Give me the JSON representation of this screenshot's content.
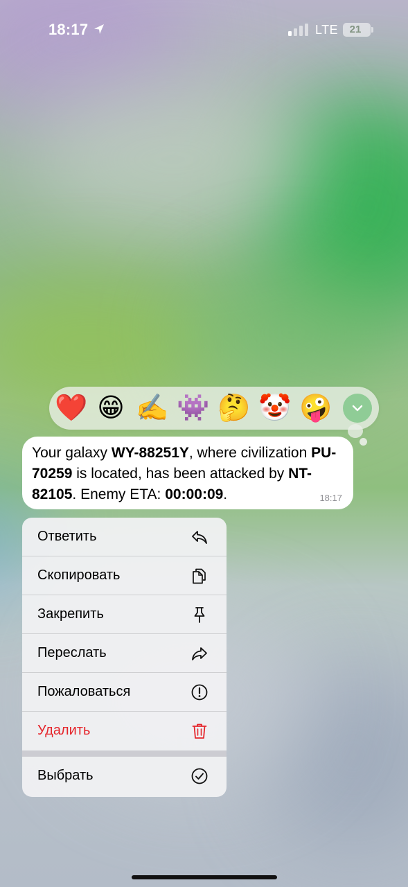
{
  "status_bar": {
    "time": "18:17",
    "network": "LTE",
    "battery": "21"
  },
  "reactions": [
    {
      "emoji": "❤️",
      "icon": "heart"
    },
    {
      "emoji": "😁",
      "icon": "grin"
    },
    {
      "emoji": "✍️",
      "icon": "writing-hand"
    },
    {
      "emoji": "👾",
      "icon": "alien-monster"
    },
    {
      "emoji": "🤔",
      "icon": "thinking-face"
    },
    {
      "emoji": "🤡",
      "icon": "clown-face"
    },
    {
      "emoji": "🤪",
      "icon": "zany-face"
    }
  ],
  "message": {
    "part1": "Your galaxy ",
    "galaxy": "WY-88251Y",
    "part2": ", where civilization ",
    "civilization": "PU-70259",
    "part3": " is located, has been attacked by ",
    "enemy": "NT-82105",
    "part4": ". Enemy ETA: ",
    "eta": "00:00:09",
    "part5": ".",
    "time": "18:17"
  },
  "menu": {
    "reply": "Ответить",
    "copy": "Скопировать",
    "pin": "Закрепить",
    "forward": "Переслать",
    "report": "Пожаловаться",
    "delete": "Удалить",
    "select": "Выбрать"
  },
  "colors": {
    "delete": "#e5262c",
    "expand_button": "#8fcc96"
  }
}
